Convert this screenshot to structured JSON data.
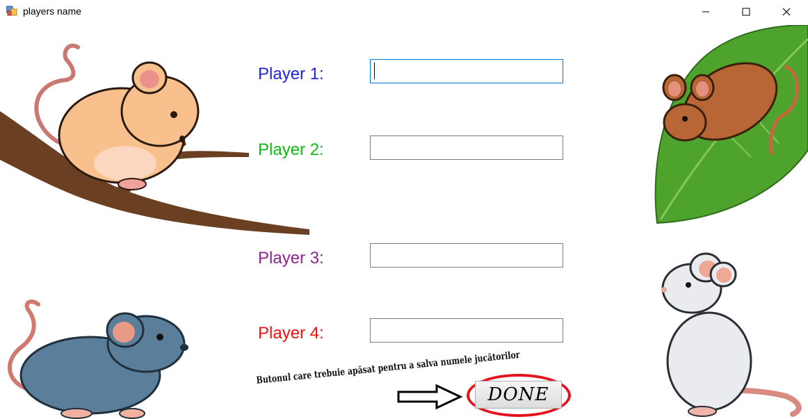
{
  "window": {
    "title": "players name",
    "controls": [
      "minimize",
      "maximize",
      "close"
    ]
  },
  "players": [
    {
      "label": "Player 1:",
      "color": "#2222dd",
      "value": ""
    },
    {
      "label": "Player 2:",
      "color": "#11bb11",
      "value": ""
    },
    {
      "label": "Player 3:",
      "color": "#8e238e",
      "value": ""
    },
    {
      "label": "Player 4:",
      "color": "#ee1111",
      "value": ""
    }
  ],
  "instruction": "Butonul care trebuie apăsat pentru a salva numele jucătorilor",
  "done_button": {
    "label": "DONE",
    "highlight_color": "#e3141b"
  },
  "illustrations": [
    "mouse-on-branch",
    "mouse-on-leaf",
    "blue-mouse",
    "white-mouse"
  ]
}
